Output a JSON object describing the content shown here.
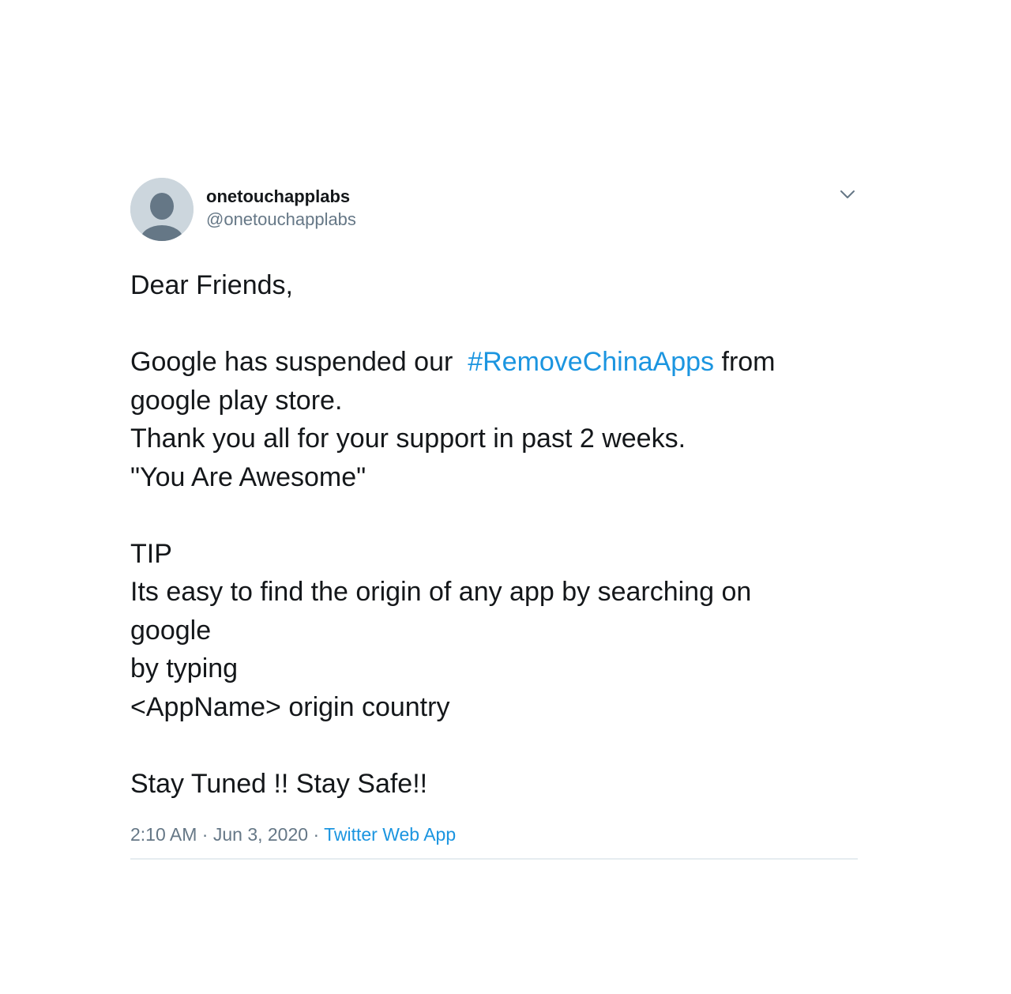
{
  "tweet": {
    "display_name": "onetouchapplabs",
    "handle": "@onetouchapplabs",
    "body": {
      "greeting": "Dear Friends,",
      "line1_before": "Google has suspended our  ",
      "hashtag": "#RemoveChinaApps",
      "line1_after": " from",
      "line2": "google play store.",
      "line3": "Thank you all for your support in past 2 weeks.",
      "line4": "\"You Are Awesome\"",
      "tip_heading": "TIP",
      "tip_line1": "Its easy to find the origin of any app by searching on",
      "tip_line2": "google",
      "tip_line3": "by typing",
      "tip_line4": "<AppName> origin country",
      "closing": "Stay Tuned !! Stay Safe!!"
    },
    "time": "2:10 AM",
    "separator": " · ",
    "date": "Jun 3, 2020",
    "source": "Twitter Web App"
  },
  "icons": {
    "avatar": "default-avatar-icon",
    "menu": "chevron-down-icon"
  },
  "colors": {
    "link": "#1b95e0",
    "text": "#14171a",
    "secondary": "#657786",
    "avatar_bg": "#ccd6dd",
    "avatar_fg": "#657786"
  }
}
